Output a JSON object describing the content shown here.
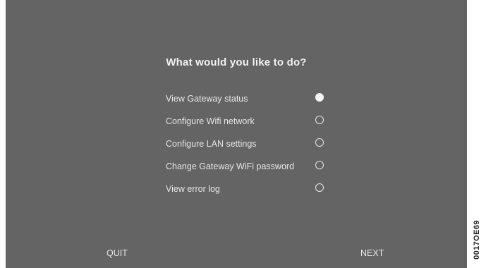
{
  "dialog": {
    "title": "What would you like to do?",
    "options": [
      {
        "label": "View Gateway status",
        "selected": true
      },
      {
        "label": "Configure Wifi network",
        "selected": false
      },
      {
        "label": "Configure LAN settings",
        "selected": false
      },
      {
        "label": "Change Gateway WiFi password",
        "selected": false
      },
      {
        "label": "View error log",
        "selected": false
      }
    ]
  },
  "footer": {
    "quit_label": "QUIT",
    "next_label": "NEXT"
  },
  "figure_code": "0017OE69",
  "colors": {
    "screen_background": "#646464",
    "text": "#e6e6e6",
    "title_text": "#f2f2f2"
  }
}
